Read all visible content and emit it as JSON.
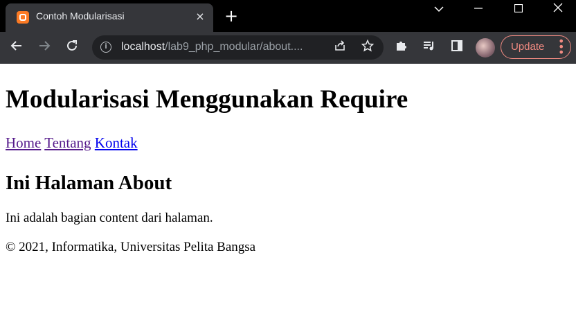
{
  "browser": {
    "tab_title": "Contoh Modularisasi",
    "tab_close_icon": "×",
    "new_tab_icon": "+",
    "address_host": "localhost",
    "address_path": "/lab9_php_modular/about....",
    "update_label": "Update"
  },
  "page": {
    "heading": "Modularisasi Menggunakan Require",
    "nav": [
      "Home",
      "Tentang",
      "Kontak"
    ],
    "subheading": "Ini Halaman About",
    "content": "Ini adalah bagian content dari halaman.",
    "footer": "© 2021, Informatika, Universitas Pelita Bangsa"
  },
  "colors": {
    "titlebar": "#000000",
    "toolbar": "#35363a",
    "omnibox": "#202124",
    "update_accent": "#f28b82",
    "link": "#0000ee",
    "visited": "#551a8b"
  }
}
